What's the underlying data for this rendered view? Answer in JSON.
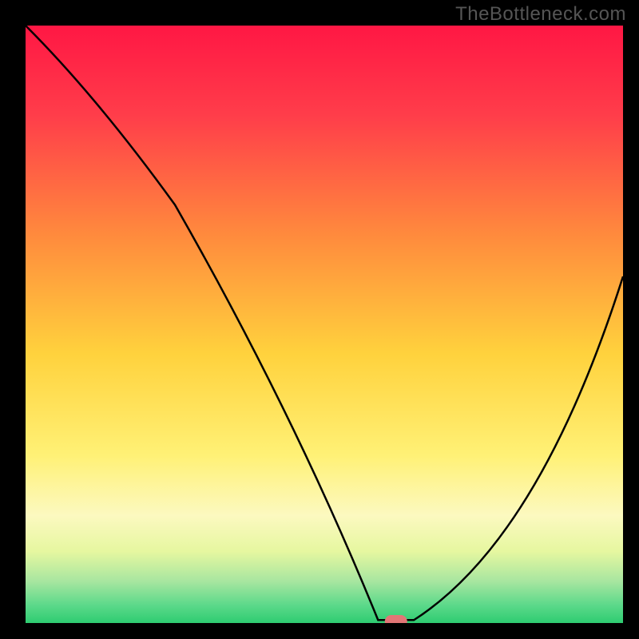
{
  "watermark": "TheBottleneck.com",
  "chart_data": {
    "type": "line",
    "title": "",
    "xlabel": "",
    "ylabel": "",
    "xlim": [
      0,
      100
    ],
    "ylim": [
      0,
      100
    ],
    "series": [
      {
        "name": "curve",
        "x": [
          0,
          25,
          59,
          62,
          65,
          100
        ],
        "values": [
          100,
          70,
          0,
          0,
          0,
          58
        ]
      }
    ],
    "marker": {
      "x": 62,
      "y": 0,
      "color": "#e27676"
    },
    "gradient_stops": [
      {
        "offset": 0.0,
        "color": "#ff1744"
      },
      {
        "offset": 0.15,
        "color": "#ff3d4a"
      },
      {
        "offset": 0.35,
        "color": "#ff8a3d"
      },
      {
        "offset": 0.55,
        "color": "#ffd23d"
      },
      {
        "offset": 0.72,
        "color": "#fff176"
      },
      {
        "offset": 0.82,
        "color": "#fcf9c0"
      },
      {
        "offset": 0.88,
        "color": "#e6f7a0"
      },
      {
        "offset": 0.93,
        "color": "#a8e6a0"
      },
      {
        "offset": 0.97,
        "color": "#5cd98a"
      },
      {
        "offset": 1.0,
        "color": "#2ecc71"
      }
    ]
  }
}
